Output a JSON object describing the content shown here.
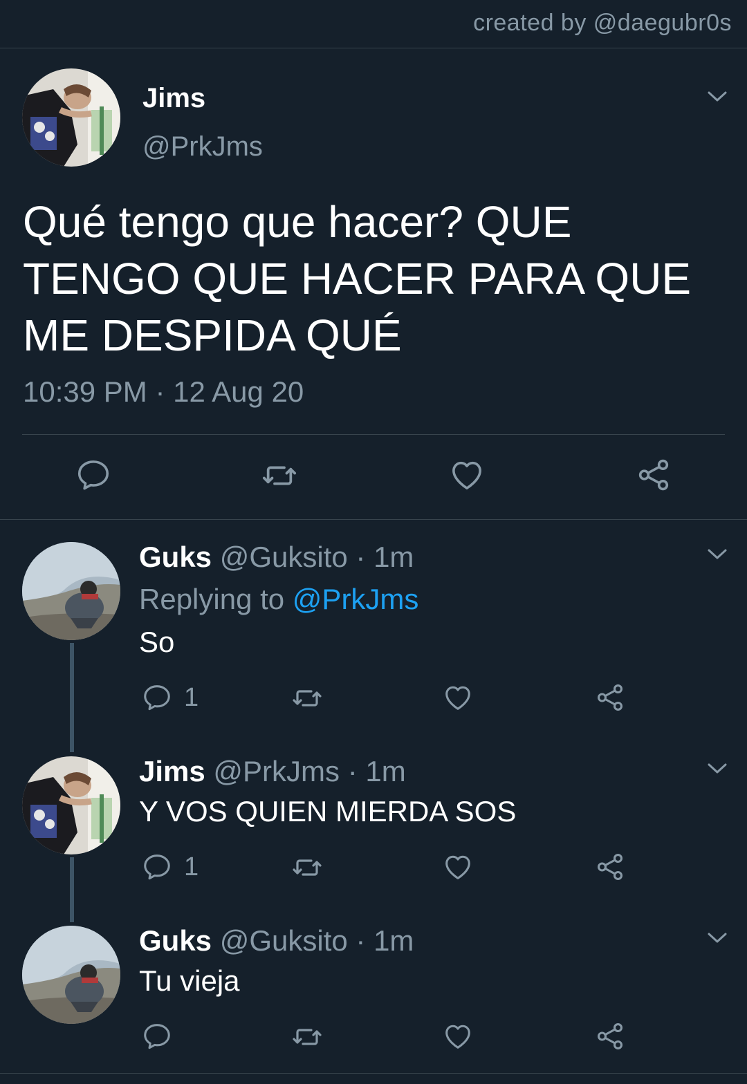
{
  "credit": "created by @daegubr0s",
  "main_tweet": {
    "name": "Jims",
    "handle": "@PrkJms",
    "text": "Qué tengo que hacer? QUE TENGO QUE HACER PARA QUE ME DESPIDA QUÉ",
    "timestamp": "10:39 PM · 12 Aug 20"
  },
  "replies": [
    {
      "name": "Guks",
      "handle": "@Guksito",
      "time": "· 1m",
      "replying_prefix": "Replying to",
      "replying_to": "@PrkJms",
      "text": "So",
      "reply_count": "1"
    },
    {
      "name": "Jims",
      "handle": "@PrkJms",
      "time": "· 1m",
      "text": "Y VOS QUIEN MIERDA SOS",
      "reply_count": "1"
    },
    {
      "name": "Guks",
      "handle": "@Guksito",
      "time": "· 1m",
      "text": "Tu vieja",
      "reply_count": ""
    }
  ],
  "colors": {
    "background": "#15202b",
    "secondary_text": "#8899a6",
    "link": "#1da1f2",
    "divider": "#38444d",
    "thread_line": "#3d5466"
  },
  "icons": {
    "reply": "comment-bubble-icon",
    "retweet": "retweet-icon",
    "like": "heart-icon",
    "share": "share-icon",
    "menu": "chevron-down-icon"
  }
}
